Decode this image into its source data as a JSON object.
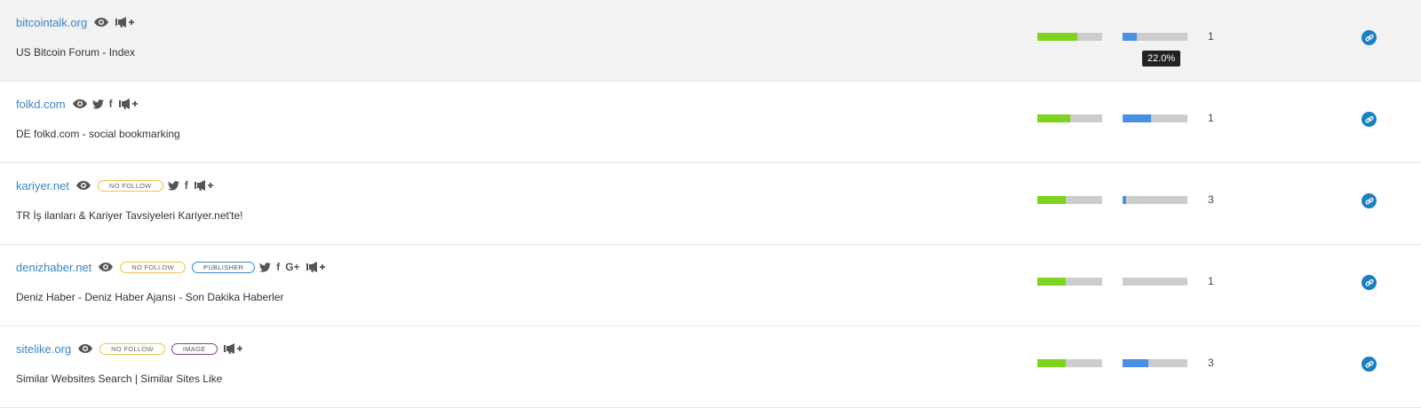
{
  "tooltip": {
    "text": "22.0%",
    "row_index": 0
  },
  "colors": {
    "link": "#3b86c8",
    "green_bar": "#7ed321",
    "blue_bar": "#4a90e2",
    "bar_bg": "#cccccc",
    "link_button": "#1a7fc3",
    "nofollow_badge": "#f0c24a",
    "publisher_badge": "#3b86c8",
    "image_badge": "#8a3e8e"
  },
  "rows": [
    {
      "domain": "bitcointalk.org",
      "title": "US Bitcoin Forum - Index",
      "badges": [],
      "social": [],
      "green": 0.62,
      "blue": 0.22,
      "count": "1",
      "hover": true
    },
    {
      "domain": "folkd.com",
      "title": "DE folkd.com - social bookmarking",
      "badges": [],
      "social": [
        "twitter-icon",
        "facebook-icon"
      ],
      "green": 0.5,
      "blue": 0.44,
      "count": "1",
      "hover": false
    },
    {
      "domain": "kariyer.net",
      "title": "TR İş ilanları & Kariyer Tavsiyeleri Kariyer.net'te!",
      "badges": [
        {
          "label": "NO FOLLOW",
          "kind": "nofollow"
        }
      ],
      "social": [
        "twitter-icon",
        "facebook-icon"
      ],
      "green": 0.44,
      "blue": 0.06,
      "count": "3",
      "hover": false
    },
    {
      "domain": "denizhaber.net",
      "title": "Deniz Haber - Deniz Haber Ajansı - Son Dakika Haberler",
      "badges": [
        {
          "label": "NO FOLLOW",
          "kind": "nofollow"
        },
        {
          "label": "PUBLISHER",
          "kind": "publisher"
        }
      ],
      "social": [
        "twitter-icon",
        "facebook-icon",
        "google-plus-icon"
      ],
      "green": 0.44,
      "blue": 0.0,
      "count": "1",
      "hover": false
    },
    {
      "domain": "sitelike.org",
      "title": "Similar Websites Search | Similar Sites Like",
      "badges": [
        {
          "label": "NO FOLLOW",
          "kind": "nofollow"
        },
        {
          "label": "IMAGE",
          "kind": "image"
        }
      ],
      "social": [],
      "green": 0.44,
      "blue": 0.4,
      "count": "3",
      "hover": false
    }
  ]
}
